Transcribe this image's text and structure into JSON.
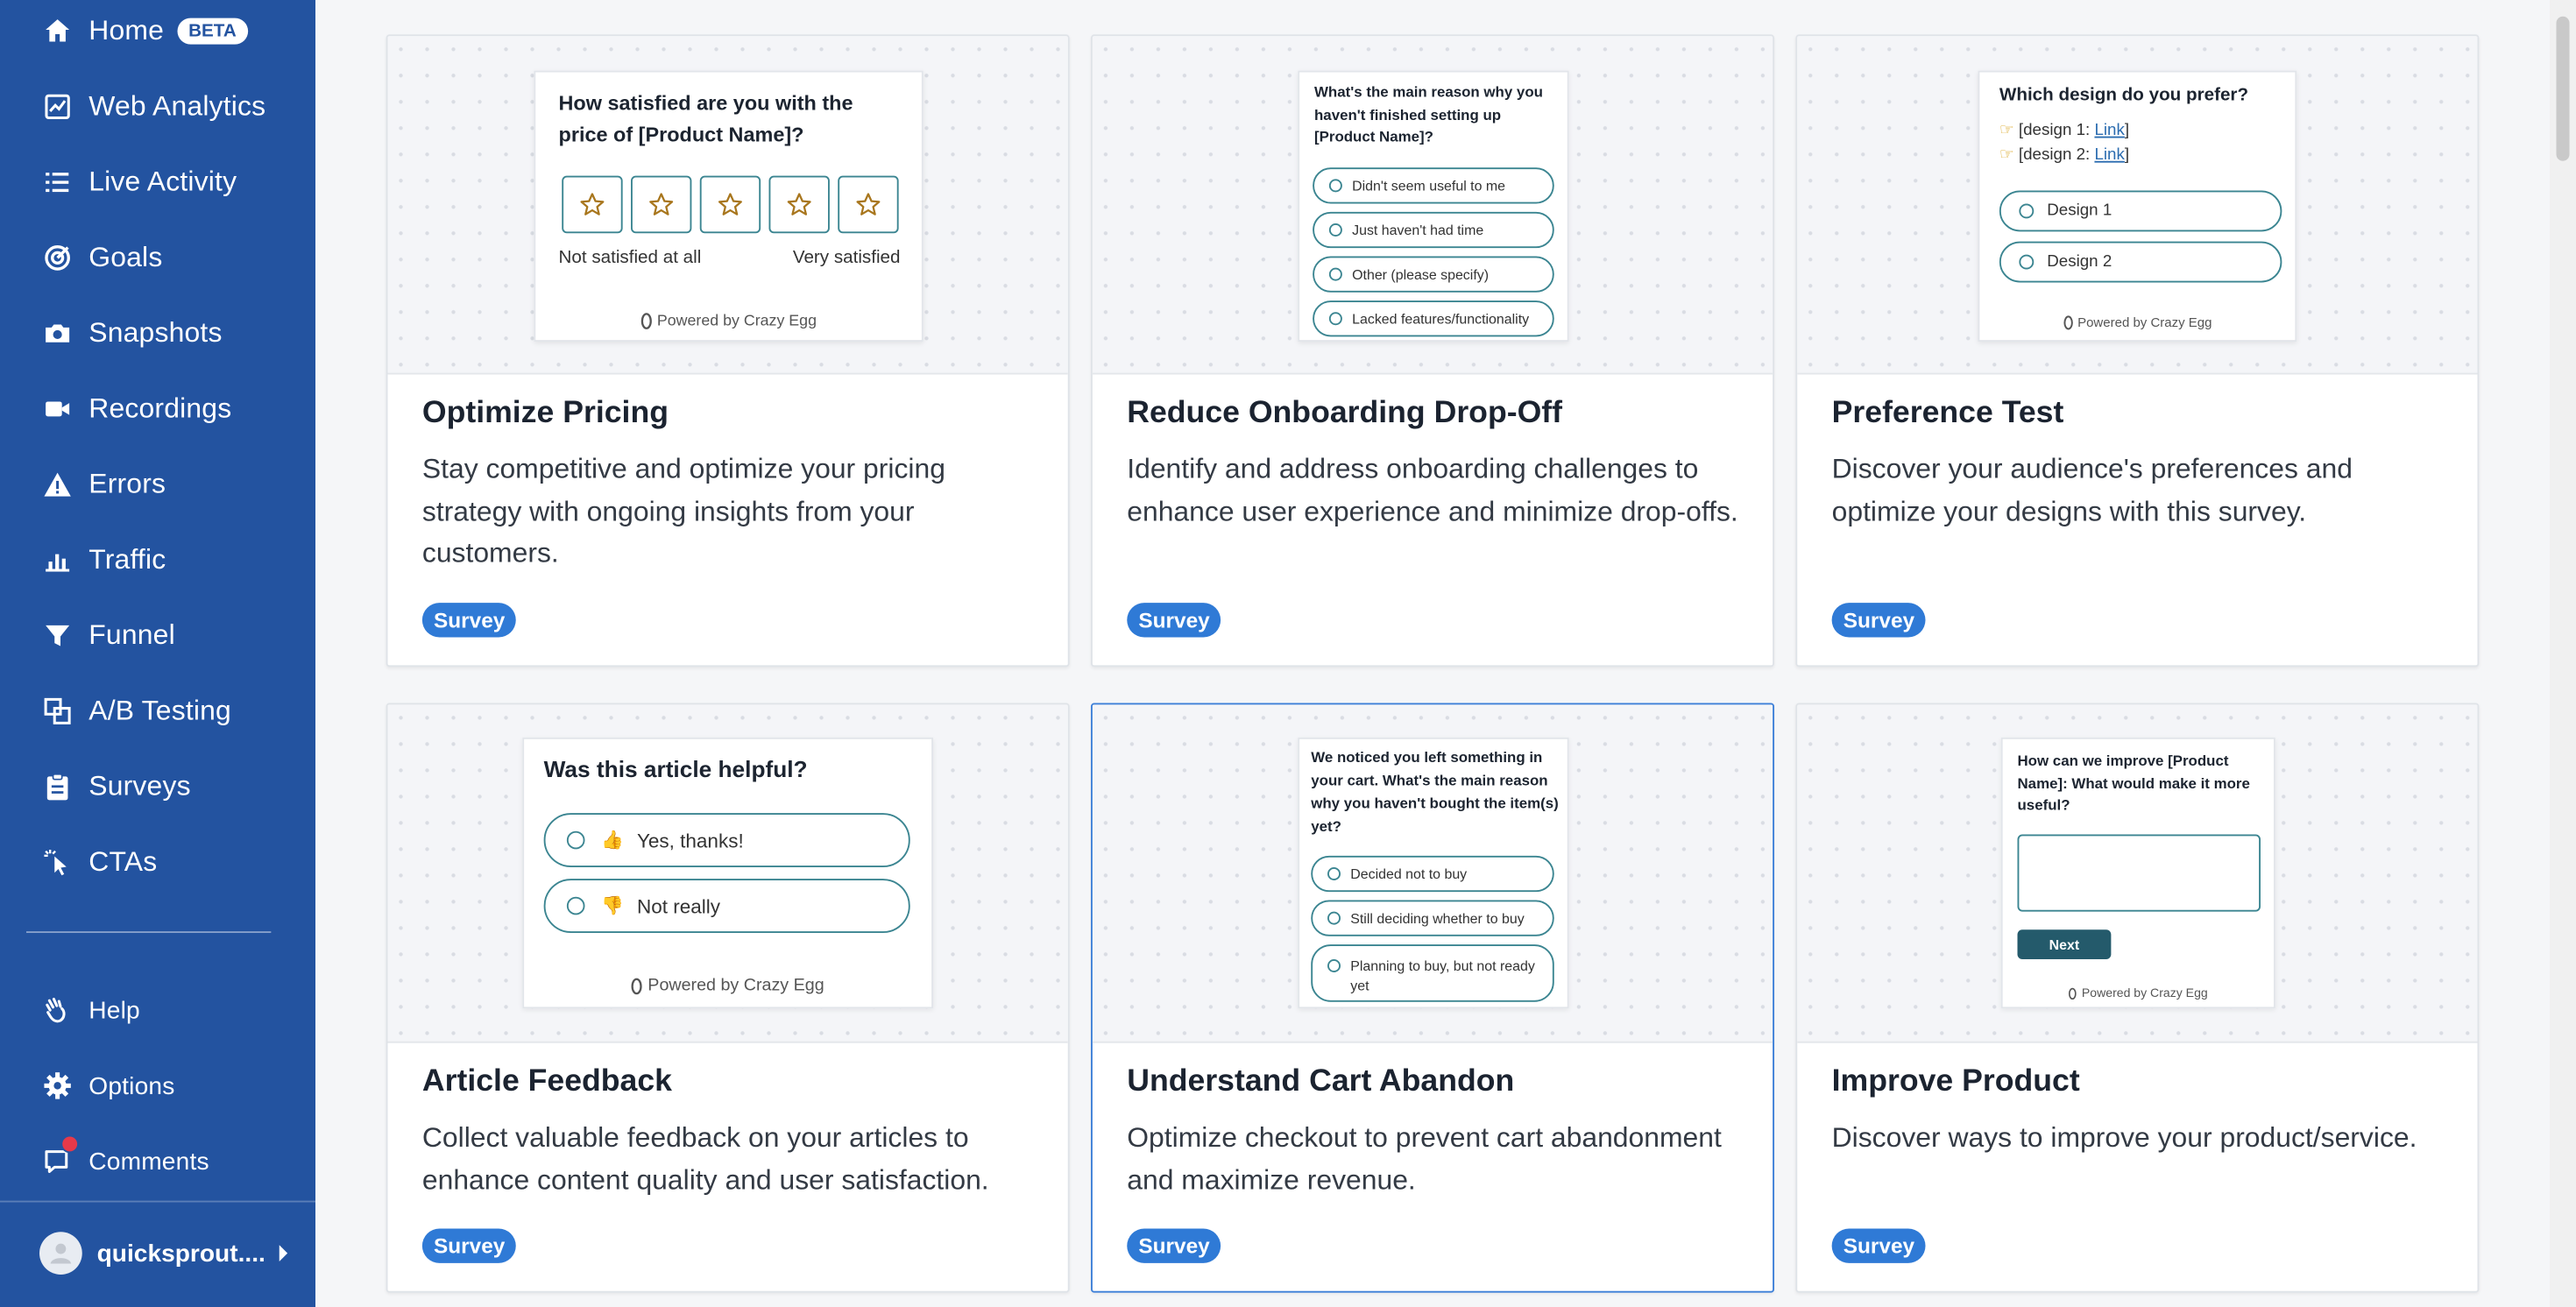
{
  "sidebar": {
    "items": [
      {
        "label": "Home",
        "icon": "home-icon"
      },
      {
        "label": "Web Analytics",
        "icon": "chart-line-icon"
      },
      {
        "label": "Live Activity",
        "icon": "list-icon"
      },
      {
        "label": "Goals",
        "icon": "target-icon"
      },
      {
        "label": "Snapshots",
        "icon": "camera-icon"
      },
      {
        "label": "Recordings",
        "icon": "video-camera-icon"
      },
      {
        "label": "Errors",
        "icon": "warning-icon"
      },
      {
        "label": "Traffic",
        "icon": "bar-chart-icon"
      },
      {
        "label": "Funnel",
        "icon": "funnel-icon"
      },
      {
        "label": "A/B Testing",
        "icon": "ab-test-icon"
      },
      {
        "label": "Surveys",
        "icon": "clipboard-icon"
      },
      {
        "label": "CTAs",
        "icon": "cursor-click-icon"
      }
    ],
    "home_badge": "BETA",
    "bottom_items": [
      {
        "label": "Help",
        "icon": "hand-wave-icon"
      },
      {
        "label": "Options",
        "icon": "gear-icon"
      },
      {
        "label": "Comments",
        "icon": "comment-icon"
      }
    ],
    "user": {
      "name": "quicksprout...."
    },
    "colors": {
      "background": "#2353a0",
      "notification": "#e5394a"
    }
  },
  "cards": [
    {
      "title": "Optimize Pricing",
      "description": "Stay competitive and optimize your pricing strategy with ongoing insights from your customers.",
      "badge": "Survey",
      "preview": {
        "question": "How satisfied are you with the price of [Product Name]?",
        "low_label": "Not satisfied at all",
        "high_label": "Very satisfied",
        "powered_by": "Powered by Crazy Egg"
      }
    },
    {
      "title": "Reduce Onboarding Drop-Off",
      "description": "Identify and address onboarding challenges to enhance user experience and minimize drop-offs.",
      "badge": "Survey",
      "preview": {
        "question": "What's the main reason why you haven't finished setting up [Product Name]?",
        "options": [
          "Didn't seem useful to me",
          "Just haven't had time",
          "Other (please specify)",
          "Lacked features/functionality"
        ]
      }
    },
    {
      "title": "Preference Test",
      "description": "Discover your audience's preferences and optimize your designs with this survey.",
      "badge": "Survey",
      "preview": {
        "question": "Which design do you prefer?",
        "design1_text": "[design 1: ",
        "design2_text": "[design 2: ",
        "link_text": "Link",
        "close_bracket": "]",
        "options": [
          "Design 1",
          "Design 2"
        ],
        "powered_by": "Powered by Crazy Egg"
      }
    },
    {
      "title": "Article Feedback",
      "description": "Collect valuable feedback on your articles to enhance content quality and user satisfaction.",
      "badge": "Survey",
      "preview": {
        "question": "Was this article helpful?",
        "options": [
          "Yes, thanks!",
          "Not really"
        ],
        "powered_by": "Powered by Crazy Egg"
      }
    },
    {
      "title": "Understand Cart Abandon",
      "description": "Optimize checkout to prevent cart abandonment and maximize revenue.",
      "badge": "Survey",
      "preview": {
        "question": "We noticed you left something in your cart. What's the main reason why you haven't bought the item(s) yet?",
        "options": [
          "Decided not to buy",
          "Still deciding whether to buy",
          "Planning to buy, but not ready yet"
        ]
      }
    },
    {
      "title": "Improve Product",
      "description": "Discover ways to improve your product/service.",
      "badge": "Survey",
      "preview": {
        "question": "How can we improve [Product Name]: What would make it more useful?",
        "button": "Next",
        "powered_by": "Powered by Crazy Egg"
      }
    }
  ],
  "colors": {
    "accent": "#2f7ad6",
    "selected_border": "#3c7fd8",
    "option_border": "#3b8591"
  }
}
